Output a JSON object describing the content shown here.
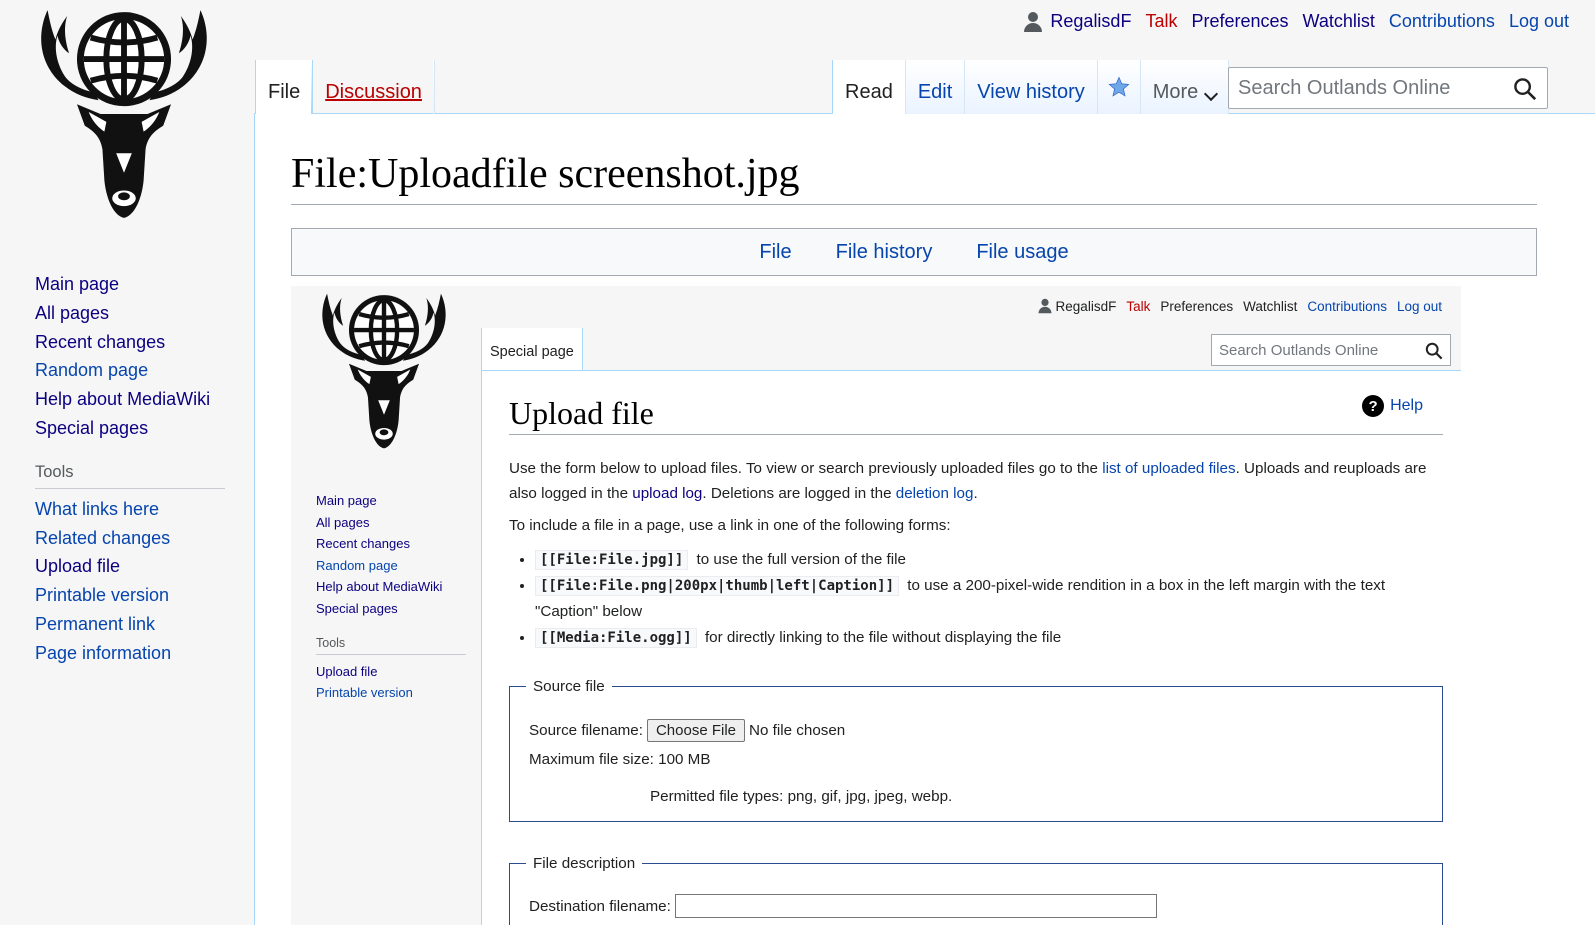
{
  "personal_tools": {
    "username": "RegalisdF",
    "talk": "Talk",
    "preferences": "Preferences",
    "watchlist": "Watchlist",
    "contributions": "Contributions",
    "logout": "Log out"
  },
  "tabs": {
    "file": "File",
    "discussion": "Discussion",
    "read": "Read",
    "edit": "Edit",
    "view_history": "View history",
    "more": "More"
  },
  "search": {
    "placeholder": "Search Outlands Online"
  },
  "sidebar": {
    "nav": [
      "Main page",
      "All pages",
      "Recent changes",
      "Random page",
      "Help about MediaWiki",
      "Special pages"
    ],
    "tools_heading": "Tools",
    "tools": [
      "What links here",
      "Related changes",
      "Upload file",
      "Printable version",
      "Permanent link",
      "Page information"
    ]
  },
  "page": {
    "title": "File:Uploadfile screenshot.jpg",
    "file_toc": [
      "File",
      "File history",
      "File usage"
    ]
  },
  "screenshot": {
    "personal_tools": {
      "username": "RegalisdF",
      "talk": "Talk",
      "preferences": "Preferences",
      "watchlist": "Watchlist",
      "contributions": "Contributions",
      "logout": "Log out"
    },
    "tab": "Special page",
    "search_placeholder": "Search Outlands Online",
    "sidebar": {
      "nav": [
        "Main page",
        "All pages",
        "Recent changes",
        "Random page",
        "Help about MediaWiki",
        "Special pages"
      ],
      "tools_heading": "Tools",
      "tools": [
        "Upload file",
        "Printable version"
      ]
    },
    "title": "Upload file",
    "help": "Help",
    "intro": {
      "p1_a": "Use the form below to upload files. To view or search previously uploaded files go to the ",
      "p1_link1": "list of uploaded files",
      "p1_b": ". Uploads and reuploads are also logged in the ",
      "p1_link2": "upload log",
      "p1_c": ". Deletions are logged in the ",
      "p1_link3": "deletion log",
      "p1_d": ".",
      "p2": "To include a file in a page, use a link in one of the following forms:",
      "bullets": [
        {
          "code": "[[File:File.jpg]]",
          "text": "to use the full version of the file"
        },
        {
          "code": "[[File:File.png|200px|thumb|left|Caption]]",
          "text": "to use a 200-pixel-wide rendition in a box in the left margin with the text \"Caption\" below"
        },
        {
          "code": "[[Media:File.ogg]]",
          "text": "for directly linking to the file without displaying the file"
        }
      ]
    },
    "source_file": {
      "legend": "Source file",
      "filename_label": "Source filename:",
      "choose_button": "Choose File",
      "no_file": "No file chosen",
      "max_size": "Maximum file size: 100 MB",
      "permitted": "Permitted file types: png, gif, jpg, jpeg, webp."
    },
    "file_description": {
      "legend": "File description",
      "dest_label": "Destination filename:"
    }
  },
  "colors": {
    "link": "#0645ad",
    "visited": "#0b0080",
    "redlink": "#ba0000",
    "star": "#36c"
  }
}
